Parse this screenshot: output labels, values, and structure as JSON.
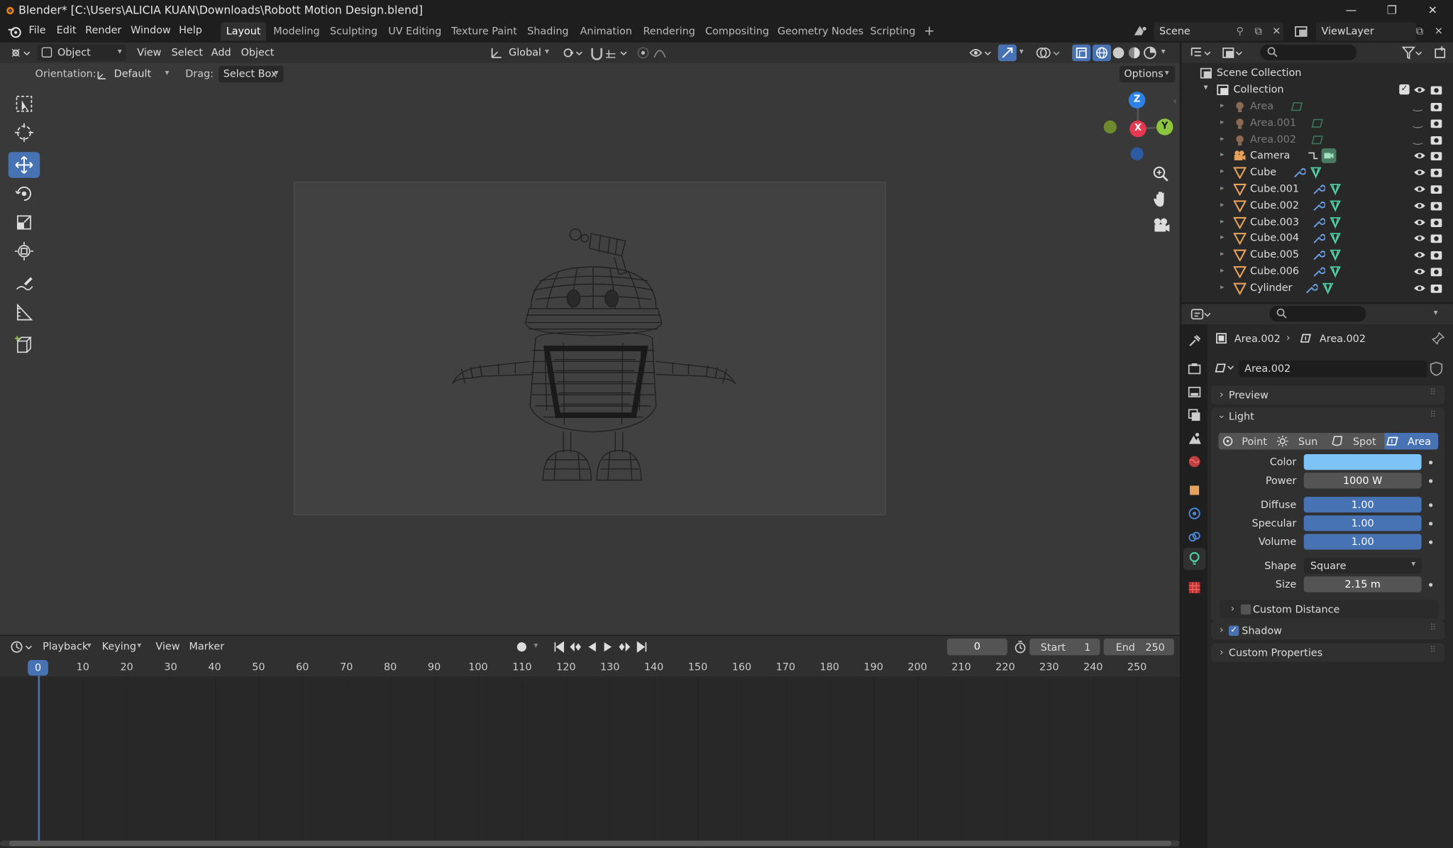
{
  "window": {
    "title": "Blender* [C:\\Users\\ALICIA KUAN\\Downloads\\Robott Motion Design.blend]",
    "minimize": "—",
    "maximize": "❐",
    "close": "✕"
  },
  "menu": {
    "items": [
      "File",
      "Edit",
      "Render",
      "Window",
      "Help"
    ]
  },
  "workspaces": [
    "Layout",
    "Modeling",
    "Sculpting",
    "UV Editing",
    "Texture Paint",
    "Shading",
    "Animation",
    "Rendering",
    "Compositing",
    "Geometry Nodes",
    "Scripting"
  ],
  "workspace_add": "+",
  "scene": {
    "name": "Scene",
    "view_layer": "ViewLayer"
  },
  "viewport_header": {
    "mode": "Object Mode",
    "menus": [
      "View",
      "Select",
      "Add",
      "Object"
    ],
    "transform_orientation": "Global",
    "orientation_label": "Orientation:",
    "orientation_value": "Default",
    "drag_label": "Drag:",
    "drag_value": "Select Box",
    "options": "Options"
  },
  "gizmo": {
    "z": "Z",
    "x": "X",
    "y": "Y"
  },
  "timeline": {
    "menus": [
      "Playback",
      "Keying",
      "View",
      "Marker"
    ],
    "current_frame": "0",
    "start_label": "Start",
    "start": "1",
    "end_label": "End",
    "end": "250",
    "ruler": [
      "0",
      "10",
      "20",
      "30",
      "40",
      "50",
      "60",
      "70",
      "80",
      "90",
      "100",
      "110",
      "120",
      "130",
      "140",
      "150",
      "160",
      "170",
      "180",
      "190",
      "200",
      "210",
      "220",
      "230",
      "240",
      "250"
    ]
  },
  "outliner": {
    "root": "Scene Collection",
    "collection": "Collection",
    "items": [
      {
        "name": "Area",
        "type": "light",
        "dim": true
      },
      {
        "name": "Area.001",
        "type": "light",
        "dim": true
      },
      {
        "name": "Area.002",
        "type": "light",
        "dim": true
      },
      {
        "name": "Camera",
        "type": "camera",
        "dim": false
      },
      {
        "name": "Cube",
        "type": "mesh",
        "dim": false
      },
      {
        "name": "Cube.001",
        "type": "mesh",
        "dim": false
      },
      {
        "name": "Cube.002",
        "type": "mesh",
        "dim": false
      },
      {
        "name": "Cube.003",
        "type": "mesh",
        "dim": false
      },
      {
        "name": "Cube.004",
        "type": "mesh",
        "dim": false
      },
      {
        "name": "Cube.005",
        "type": "mesh",
        "dim": false
      },
      {
        "name": "Cube.006",
        "type": "mesh",
        "dim": false
      },
      {
        "name": "Cylinder",
        "type": "mesh",
        "dim": false
      }
    ]
  },
  "properties": {
    "breadcrumb": {
      "object": "Area.002",
      "data": "Area.002"
    },
    "datablock": "Area.002",
    "panels": {
      "preview": "Preview",
      "light": "Light",
      "custom_distance": "Custom Distance",
      "shadow": "Shadow",
      "custom_properties": "Custom Properties"
    },
    "light_types": [
      "Point",
      "Sun",
      "Spot",
      "Area"
    ],
    "active_light_type": "Area",
    "fields": {
      "color_label": "Color",
      "color": "#7ec3f7",
      "power_label": "Power",
      "power": "1000 W",
      "diffuse_label": "Diffuse",
      "diffuse": "1.00",
      "specular_label": "Specular",
      "specular": "1.00",
      "volume_label": "Volume",
      "volume": "1.00",
      "shape_label": "Shape",
      "shape": "Square",
      "size_label": "Size",
      "size": "2.15 m"
    }
  },
  "colors": {
    "accent": "#4772b3",
    "axis_x": "#e8384f",
    "axis_y": "#8cc63f",
    "axis_z": "#2e81e6",
    "light_icon": "#c88b5e",
    "mesh_icon": "#e6a25a"
  }
}
